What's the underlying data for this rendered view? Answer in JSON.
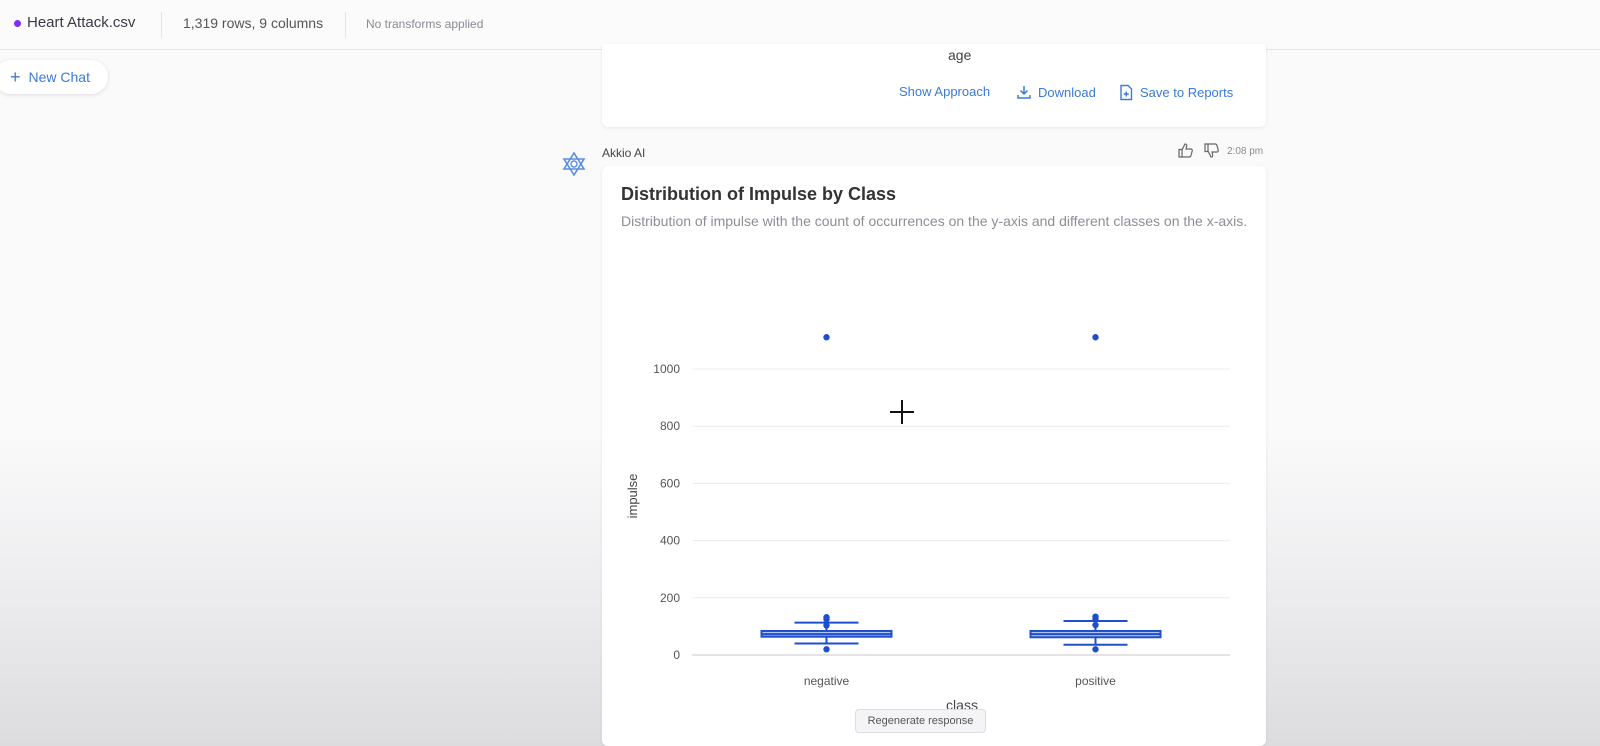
{
  "topbar": {
    "file_name": "Heart Attack.csv",
    "rows_info": "1,319 rows, 9 columns",
    "transforms": "No transforms applied",
    "file_dot_color": "#7b2ff7"
  },
  "sidebar": {
    "new_chat_label": "New Chat",
    "new_chat_icon": "plus-icon"
  },
  "previous_card": {
    "axis_label": "age",
    "actions": {
      "show_approach": "Show Approach",
      "download": "Download",
      "save_to_reports": "Save to Reports"
    }
  },
  "message": {
    "author": "Akkio AI",
    "time": "2:08 pm",
    "avatar_icon": "akkio-logo-icon",
    "feedback_icons": [
      "thumbs-up-icon",
      "thumbs-down-icon"
    ],
    "title": "Distribution of Impulse by Class",
    "description": "Distribution of impulse with the count of occurrences on the y-axis and different classes on the x-axis.",
    "regenerate_label": "Regenerate response"
  },
  "accent_color": "#3a7bd5",
  "chart_data": {
    "type": "box",
    "xlabel": "class",
    "ylabel": "impulse",
    "ylim": [
      0,
      1100
    ],
    "yticks": [
      0,
      200,
      400,
      600,
      800,
      1000
    ],
    "grid": true,
    "color": "#1f4fc9",
    "categories": [
      "negative",
      "positive"
    ],
    "boxes": [
      {
        "category": "negative",
        "whisker_low": 40,
        "q1": 64,
        "median": 73,
        "q3": 84,
        "whisker_high": 113,
        "outliers": [
          20,
          103,
          125,
          132,
          1111
        ]
      },
      {
        "category": "positive",
        "whisker_low": 36,
        "q1": 62,
        "median": 73,
        "q3": 84,
        "whisker_high": 119,
        "outliers": [
          20,
          105,
          125,
          134,
          1111
        ]
      }
    ]
  }
}
